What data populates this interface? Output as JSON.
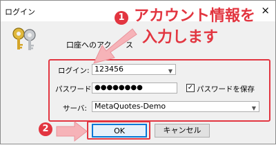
{
  "window": {
    "title": "ログイン",
    "close": "×"
  },
  "message": "口座へのアク",
  "message_tail": "ス",
  "form": {
    "login_label": "ログイン:",
    "login_value": "123456",
    "password_label": "パスワード：",
    "password_value": "●●●●●●●●",
    "save_password_label": "パスワードを保存",
    "save_password_checked": true,
    "server_label": "サーバ:",
    "server_value": "MetaQuotes-Demo"
  },
  "buttons": {
    "ok": "OK",
    "cancel": "キャンセル"
  },
  "annotations": {
    "step1_number": "1",
    "step1_text_line1": "アカウント情報を",
    "step1_text_line2": "入力します",
    "step2_number": "2",
    "highlight_color": "#e23540"
  }
}
